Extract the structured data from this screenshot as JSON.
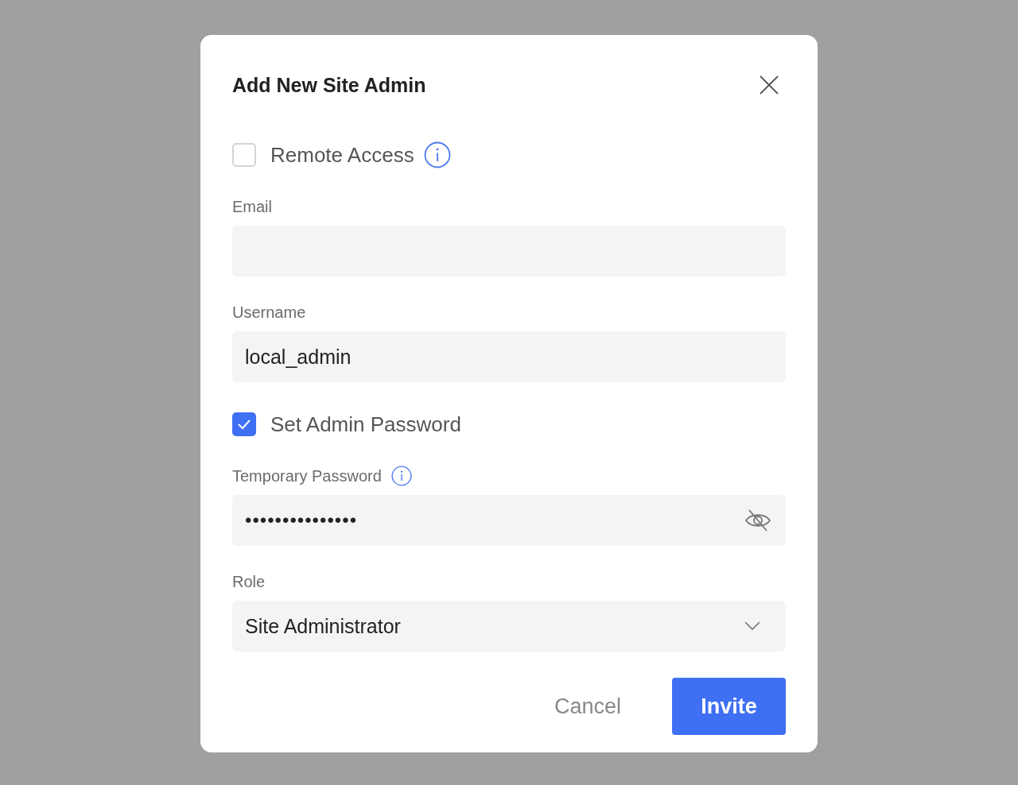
{
  "dialog": {
    "title": "Add New Site Admin"
  },
  "items": [
    {
      "kind": "checkbox",
      "label": "Remote Access",
      "checked": false,
      "info": true
    },
    {
      "kind": "text",
      "label": "Email"
    },
    {
      "kind": "text",
      "label": "Username",
      "value": "local_admin"
    },
    {
      "kind": "checkbox",
      "label": "Set Admin Password",
      "checked": true
    },
    {
      "kind": "password",
      "label": "Temporary Password",
      "info": true,
      "value": "•••••••••••••••",
      "revealed": false
    },
    {
      "kind": "select",
      "label": "Role",
      "value": "Site Administrator"
    }
  ],
  "buttons": [
    {
      "label": "Cancel",
      "kind": "secondary"
    },
    {
      "label": "Invite",
      "kind": "primary"
    }
  ]
}
